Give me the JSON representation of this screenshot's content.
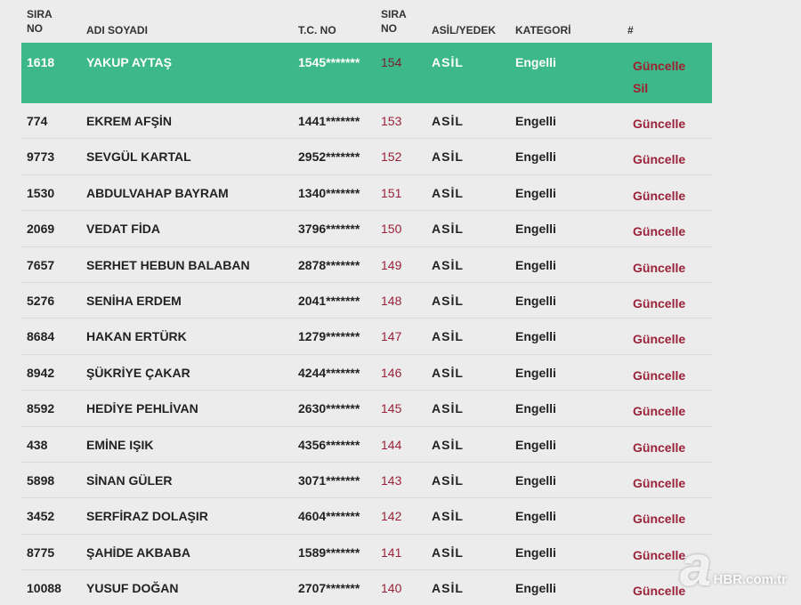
{
  "header": {
    "sira_no_line1": "SIRA",
    "sira_no_line2": "NO",
    "ad_soyadi": "ADI SOYADI",
    "tc_no": "T.C. NO",
    "sira2_line1": "SIRA",
    "sira2_line2": "NO",
    "asil_yedek": "ASİL/YEDEK",
    "kategori": "KATEGORİ",
    "hash": "#"
  },
  "rows": [
    {
      "no": "1618",
      "name": "YAKUP AYTAŞ",
      "tc": "1545*******",
      "sira": "154",
      "asil": "ASİL",
      "kategori": "Engelli",
      "update": "Güncelle",
      "delete": "Sil"
    },
    {
      "no": "774",
      "name": "EKREM AFŞİN",
      "tc": "1441*******",
      "sira": "153",
      "asil": "ASİL",
      "kategori": "Engelli",
      "update": "Güncelle"
    },
    {
      "no": "9773",
      "name": "SEVGÜL KARTAL",
      "tc": "2952*******",
      "sira": "152",
      "asil": "ASİL",
      "kategori": "Engelli",
      "update": "Güncelle"
    },
    {
      "no": "1530",
      "name": "ABDULVAHAP BAYRAM",
      "tc": "1340*******",
      "sira": "151",
      "asil": "ASİL",
      "kategori": "Engelli",
      "update": "Güncelle"
    },
    {
      "no": "2069",
      "name": "VEDAT FİDA",
      "tc": "3796*******",
      "sira": "150",
      "asil": "ASİL",
      "kategori": "Engelli",
      "update": "Güncelle"
    },
    {
      "no": "7657",
      "name": "SERHET HEBUN BALABAN",
      "tc": "2878*******",
      "sira": "149",
      "asil": "ASİL",
      "kategori": "Engelli",
      "update": "Güncelle"
    },
    {
      "no": "5276",
      "name": "SENİHA ERDEM",
      "tc": "2041*******",
      "sira": "148",
      "asil": "ASİL",
      "kategori": "Engelli",
      "update": "Güncelle"
    },
    {
      "no": "8684",
      "name": "HAKAN ERTÜRK",
      "tc": "1279*******",
      "sira": "147",
      "asil": "ASİL",
      "kategori": "Engelli",
      "update": "Güncelle"
    },
    {
      "no": "8942",
      "name": "ŞÜKRİYE ÇAKAR",
      "tc": "4244*******",
      "sira": "146",
      "asil": "ASİL",
      "kategori": "Engelli",
      "update": "Güncelle"
    },
    {
      "no": "8592",
      "name": "HEDİYE PEHLİVAN",
      "tc": "2630*******",
      "sira": "145",
      "asil": "ASİL",
      "kategori": "Engelli",
      "update": "Güncelle"
    },
    {
      "no": "438",
      "name": "EMİNE IŞIK",
      "tc": "4356*******",
      "sira": "144",
      "asil": "ASİL",
      "kategori": "Engelli",
      "update": "Güncelle"
    },
    {
      "no": "5898",
      "name": "SİNAN GÜLER",
      "tc": "3071*******",
      "sira": "143",
      "asil": "ASİL",
      "kategori": "Engelli",
      "update": "Güncelle"
    },
    {
      "no": "3452",
      "name": "SERFİRAZ DOLAŞIR",
      "tc": "4604*******",
      "sira": "142",
      "asil": "ASİL",
      "kategori": "Engelli",
      "update": "Güncelle"
    },
    {
      "no": "8775",
      "name": "ŞAHİDE AKBABA",
      "tc": "1589*******",
      "sira": "141",
      "asil": "ASİL",
      "kategori": "Engelli",
      "update": "Güncelle"
    },
    {
      "no": "10088",
      "name": "YUSUF DOĞAN",
      "tc": "2707*******",
      "sira": "140",
      "asil": "ASİL",
      "kategori": "Engelli",
      "update": "Güncelle"
    }
  ],
  "highlight_row_index": 0,
  "colors": {
    "highlight": "#3db88a",
    "link": "#9a2239",
    "background": "#ececec"
  },
  "watermark": {
    "logo": "a",
    "site": "HBR.com.tr"
  }
}
